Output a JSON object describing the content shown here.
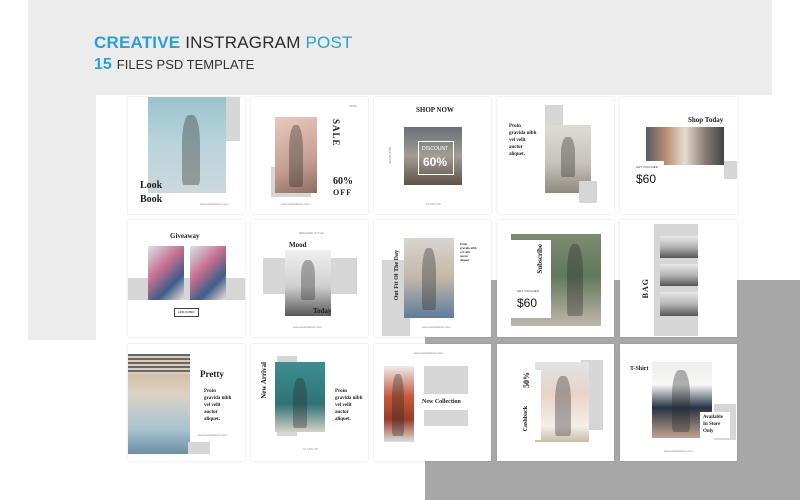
{
  "header": {
    "word_creative": "CREATIVE",
    "word_instagram": "INSTRAGRAM",
    "word_post": "POST",
    "count": "15",
    "subtitle": "FILES PSD TEMPLATE"
  },
  "colors": {
    "accent": "#2a9fd6",
    "gray_block": "#ececec",
    "dark_block": "#a7a7a7"
  },
  "posts": {
    "lookbook": {
      "title_line1": "Look",
      "title_line2": "Book",
      "url": "www.websitebon.com"
    },
    "sale": {
      "label": "SALE",
      "percent": "60%",
      "off": "OFF",
      "number": "02/09",
      "url": "www.websitebon.com"
    },
    "shopnow": {
      "title": "SHOP NOW",
      "discount_label": "DISCOUNT",
      "discount_value": "60%",
      "side": "NEW MODE",
      "footer": "CLASS UP"
    },
    "proin1": {
      "text": "Proin\ngravida nibh\nvel velit\nauctor\naliquet."
    },
    "shoptoday": {
      "title": "Shop Today",
      "voucher": "GET VOUCHER",
      "price": "$60"
    },
    "giveaway": {
      "title": "Giveaway",
      "button": "LINK IN BIO"
    },
    "mood": {
      "kicker": "BREAKER STYLE",
      "title": "Mood",
      "today": "Today",
      "url": "www.websitebon.com"
    },
    "outfit": {
      "title": "Out Fit Of The Day",
      "url": "www.websitebon.com"
    },
    "subscribe": {
      "title": "Subscribe",
      "voucher": "GET VOUCHER",
      "price": "$60"
    },
    "bag": {
      "title": "BAG"
    },
    "pretty": {
      "title": "Pretty",
      "text": "Proin\ngravida nibh\nvel velit\nauctor\naliquet.",
      "url": "www.websitebon.com"
    },
    "newarrival": {
      "title": "New Arrival",
      "text": "Proin\ngravida nibh\nvel velit\nauctor\naliquet.",
      "footer": "CLASS UP"
    },
    "newcollection": {
      "title": "New Collection",
      "url": "www.websitebon.com"
    },
    "cashback": {
      "title": "Cashback",
      "percent": "50%"
    },
    "tshirt": {
      "title": "T-Shirt",
      "store_line1": "Available",
      "store_line2": "In Store",
      "store_line3": "Only",
      "url": "www.websitebon.com"
    }
  }
}
